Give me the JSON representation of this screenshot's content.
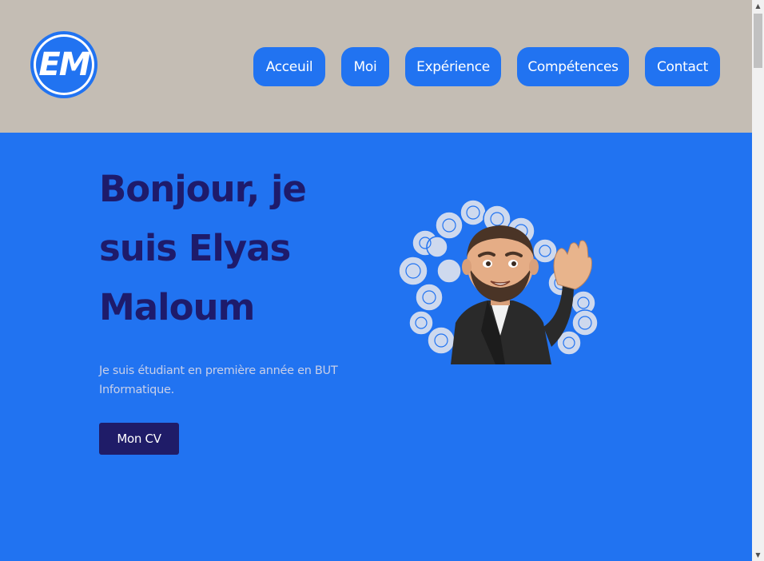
{
  "header": {
    "logo_text": "EM",
    "nav": [
      {
        "label": "Acceuil"
      },
      {
        "label": "Moi"
      },
      {
        "label": "Expérience"
      },
      {
        "label": "Compétences"
      },
      {
        "label": "Contact"
      }
    ]
  },
  "hero": {
    "title_lines": [
      "Bonjour, je",
      "suis Elyas",
      "Maloum"
    ],
    "subtitle_lines": [
      "Je suis étudiant en première année en BUT",
      "Informatique."
    ],
    "cv_button": "Mon CV"
  },
  "icons": {
    "scroll_up": "chevron-up-icon",
    "scroll_down": "chevron-down-icon",
    "avatar": "memoji-waving-avatar"
  },
  "colors": {
    "header_bg": "#c4bdb4",
    "accent": "#2173f1",
    "title": "#1e1b6b",
    "cv_button": "#1f1c68"
  }
}
